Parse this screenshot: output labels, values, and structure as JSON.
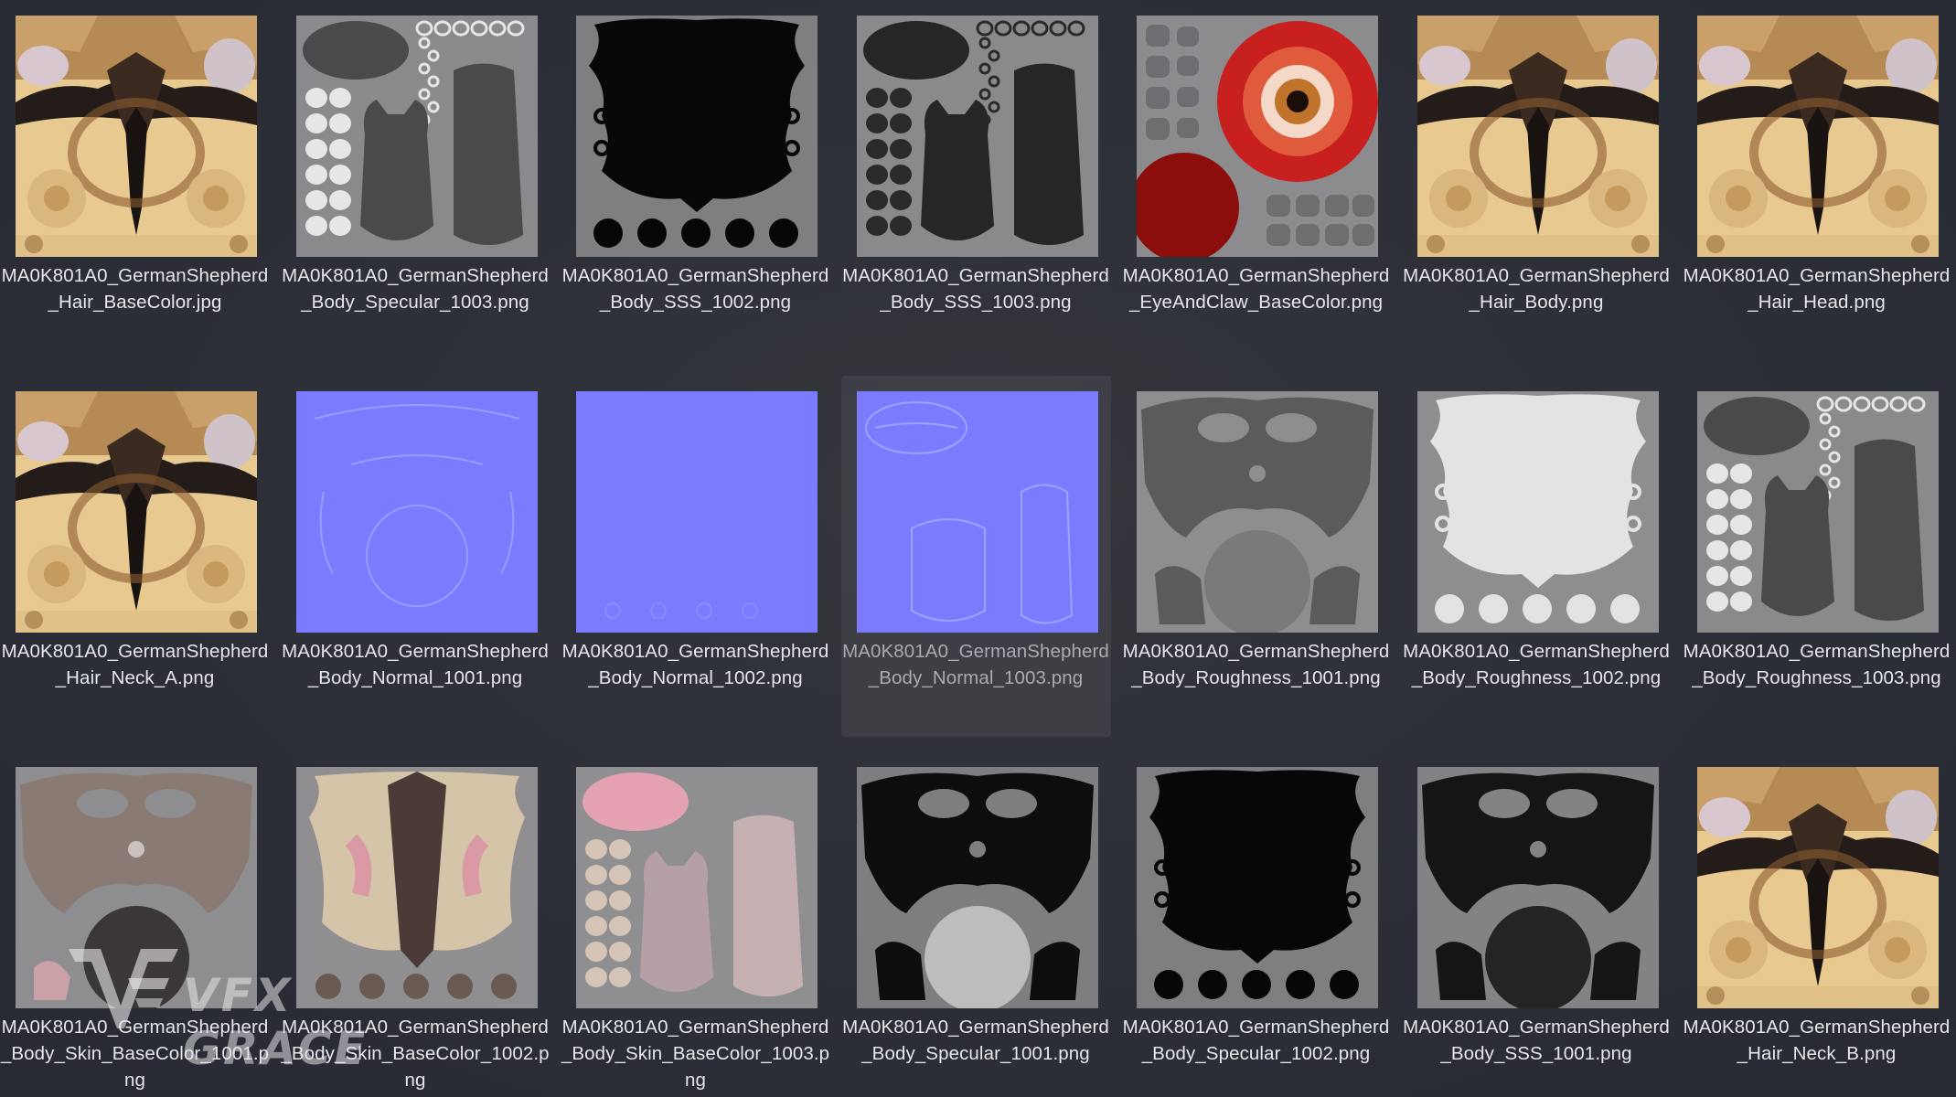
{
  "files": [
    {
      "name": "MA0K801A0_GermanShepherd\n_Hair_BaseColor.jpg",
      "thumb": "hair",
      "selected": false
    },
    {
      "name": "MA0K801A0_GermanShepherd\n_Body_Specular_1003.png",
      "thumb": "uv3_gray",
      "selected": false
    },
    {
      "name": "MA0K801A0_GermanShepherd\n_Body_SSS_1002.png",
      "thumb": "uv2_dark",
      "selected": false
    },
    {
      "name": "MA0K801A0_GermanShepherd\n_Body_SSS_1003.png",
      "thumb": "uv3_dark",
      "selected": false
    },
    {
      "name": "MA0K801A0_GermanShepherd\n_EyeAndClaw_BaseColor.png",
      "thumb": "eye",
      "selected": false
    },
    {
      "name": "MA0K801A0_GermanShepherd\n_Hair_Body.png",
      "thumb": "hair",
      "selected": false
    },
    {
      "name": "MA0K801A0_GermanShepherd\n_Hair_Head.png",
      "thumb": "hair",
      "selected": false
    },
    {
      "name": "MA0K801A0_GermanShepherd\n_Hair_Neck_A.png",
      "thumb": "hair",
      "selected": false
    },
    {
      "name": "MA0K801A0_GermanShepherd\n_Body_Normal_1001.png",
      "thumb": "normal1",
      "selected": false
    },
    {
      "name": "MA0K801A0_GermanShepherd\n_Body_Normal_1002.png",
      "thumb": "normal2",
      "selected": false
    },
    {
      "name": "MA0K801A0_GermanShepherd\n_Body_Normal_1003.png",
      "thumb": "normal3",
      "selected": true
    },
    {
      "name": "MA0K801A0_GermanShepherd\n_Body_Roughness_1001.png",
      "thumb": "uv1_gray",
      "selected": false
    },
    {
      "name": "MA0K801A0_GermanShepherd\n_Body_Roughness_1002.png",
      "thumb": "uv2_light",
      "selected": false
    },
    {
      "name": "MA0K801A0_GermanShepherd\n_Body_Roughness_1003.png",
      "thumb": "uv3_gray",
      "selected": false
    },
    {
      "name": "MA0K801A0_GermanShepherd\n_Body_Skin_BaseColor_1001.p\nng",
      "thumb": "skin1",
      "selected": false
    },
    {
      "name": "MA0K801A0_GermanShepherd\n_Body_Skin_BaseColor_1002.p\nng",
      "thumb": "skin2",
      "selected": false
    },
    {
      "name": "MA0K801A0_GermanShepherd\n_Body_Skin_BaseColor_1003.p\nng",
      "thumb": "skin3",
      "selected": false
    },
    {
      "name": "MA0K801A0_GermanShepherd\n_Body_Specular_1001.png",
      "thumb": "uv1_dark",
      "selected": false
    },
    {
      "name": "MA0K801A0_GermanShepherd\n_Body_Specular_1002.png",
      "thumb": "uv2_dark",
      "selected": false
    },
    {
      "name": "MA0K801A0_GermanShepherd\n_Body_SSS_1001.png",
      "thumb": "uv1_black",
      "selected": false
    },
    {
      "name": "MA0K801A0_GermanShepherd\n_Hair_Neck_B.png",
      "thumb": "hair",
      "selected": false
    }
  ],
  "watermark": {
    "text": "VFX GRACE",
    "logo": "vfx-grace-logo-icon"
  }
}
